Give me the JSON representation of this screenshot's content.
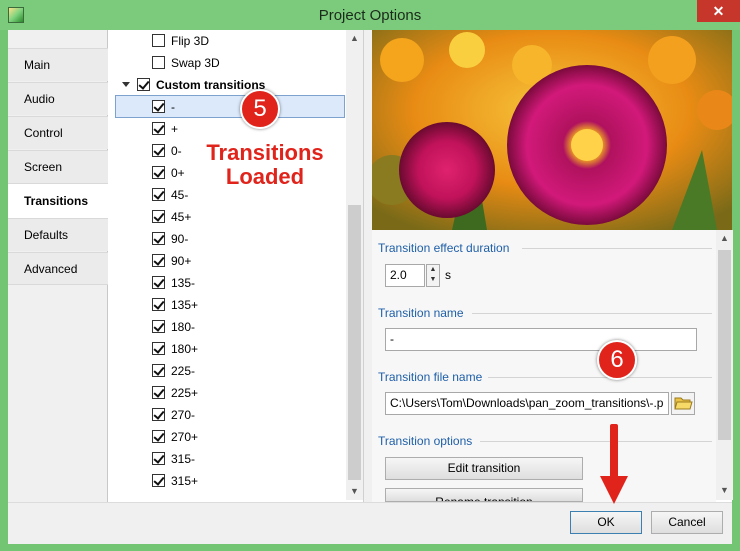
{
  "window": {
    "title": "Project Options",
    "close_glyph": "✕"
  },
  "tabs": [
    {
      "label": "Main"
    },
    {
      "label": "Audio"
    },
    {
      "label": "Control"
    },
    {
      "label": "Screen"
    },
    {
      "label": "Transitions"
    },
    {
      "label": "Defaults"
    },
    {
      "label": "Advanced"
    }
  ],
  "tree": {
    "pre_items": [
      "Flip 3D",
      "Swap 3D"
    ],
    "group_label": "Custom transitions",
    "items": [
      "-",
      "+",
      "0-",
      "0+",
      "45-",
      "45+",
      "90-",
      "90+",
      "135-",
      "135+",
      "180-",
      "180+",
      "225-",
      "225+",
      "270-",
      "270+",
      "315-",
      "315+"
    ]
  },
  "form": {
    "duration_label": "Transition effect duration",
    "duration_value": "2.0",
    "duration_unit": "s",
    "name_label": "Transition name",
    "name_value": "-",
    "file_label": "Transition file name",
    "file_value": "C:\\Users\\Tom\\Downloads\\pan_zoom_transitions\\-.p",
    "options_label": "Transition options",
    "edit_button": "Edit transition",
    "rename_button": "Rename transition"
  },
  "footer": {
    "ok": "OK",
    "cancel": "Cancel"
  },
  "annotations": {
    "step5": "5",
    "step6": "6",
    "loaded_line1": "Transitions",
    "loaded_line2": "Loaded"
  },
  "colors": {
    "accent": "#1f5fa8",
    "annotation": "#e0241b",
    "titlebar": "#7ccb7c"
  }
}
